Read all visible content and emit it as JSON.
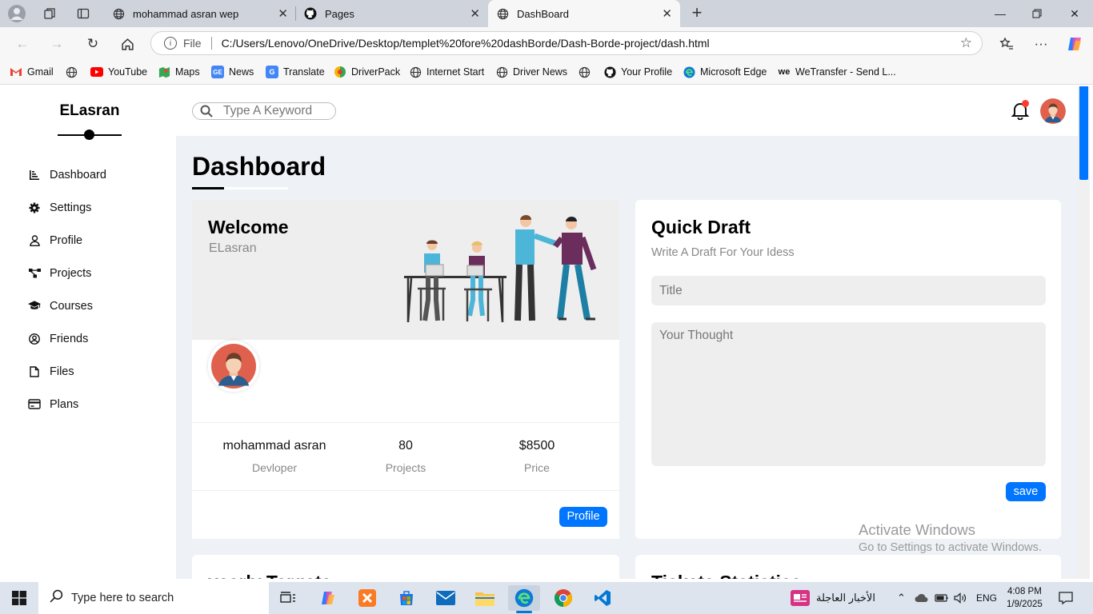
{
  "browser": {
    "tabs": [
      {
        "title": "mohammad asran wep",
        "icon": "globe-icon"
      },
      {
        "title": "Pages",
        "icon": "github-icon"
      },
      {
        "title": "DashBoard",
        "icon": "globe-icon",
        "active": true
      }
    ],
    "address": {
      "scheme_label": "File",
      "url": "C:/Users/Lenovo/OneDrive/Desktop/templet%20fore%20dashBorde/Dash-Borde-project/dash.html"
    },
    "bookmarks": [
      {
        "label": "Gmail",
        "icon": "gmail-icon"
      },
      {
        "label": "",
        "icon": "globe-icon"
      },
      {
        "label": "YouTube",
        "icon": "youtube-icon"
      },
      {
        "label": "Maps",
        "icon": "maps-icon"
      },
      {
        "label": "News",
        "icon": "news-icon"
      },
      {
        "label": "Translate",
        "icon": "translate-icon"
      },
      {
        "label": "DriverPack",
        "icon": "driverpack-icon"
      },
      {
        "label": "Internet Start",
        "icon": "globe-icon"
      },
      {
        "label": "Driver News",
        "icon": "globe-icon"
      },
      {
        "label": "",
        "icon": "globe-icon"
      },
      {
        "label": "Your Profile",
        "icon": "github-icon"
      },
      {
        "label": "Microsoft Edge",
        "icon": "edge-icon"
      },
      {
        "label": "WeTransfer - Send L...",
        "icon": "wetransfer-icon"
      }
    ]
  },
  "sidebar": {
    "brand": "ELasran",
    "items": [
      {
        "label": "Dashboard",
        "icon": "chart-icon"
      },
      {
        "label": "Settings",
        "icon": "gear-icon"
      },
      {
        "label": "Profile",
        "icon": "user-icon"
      },
      {
        "label": "Projects",
        "icon": "diagram-icon"
      },
      {
        "label": "Courses",
        "icon": "graduation-cap-icon"
      },
      {
        "label": "Friends",
        "icon": "user-circle-icon"
      },
      {
        "label": "Files",
        "icon": "file-icon"
      },
      {
        "label": "Plans",
        "icon": "credit-card-icon"
      }
    ]
  },
  "topbar": {
    "search_placeholder": "Type A Keyword"
  },
  "page": {
    "title": "Dashboard"
  },
  "welcome": {
    "title": "Welcome",
    "subtitle": "ELasran",
    "stats": [
      {
        "value": "mohammad asran",
        "label": "Devloper"
      },
      {
        "value": "80",
        "label": "Projects"
      },
      {
        "value": "$8500",
        "label": "Price"
      }
    ],
    "button": "Profile"
  },
  "draft": {
    "title": "Quick Draft",
    "subtitle": "Write A Draft For Your Idess",
    "title_placeholder": "Title",
    "body_placeholder": "Your Thought",
    "button": "save"
  },
  "partial_cards": [
    "yearly Targets",
    "Tickets Statistics"
  ],
  "watermark": {
    "line1": "Activate Windows",
    "line2": "Go to Settings to activate Windows."
  },
  "taskbar": {
    "search_placeholder": "Type here to search",
    "news_label": "الأخبار العاجلة",
    "lang": "ENG",
    "time": "4:08 PM",
    "date": "1/9/2025"
  },
  "colors": {
    "accent": "#0075ff",
    "page_bg": "#eef1f5",
    "notify": "#ff3b30"
  }
}
